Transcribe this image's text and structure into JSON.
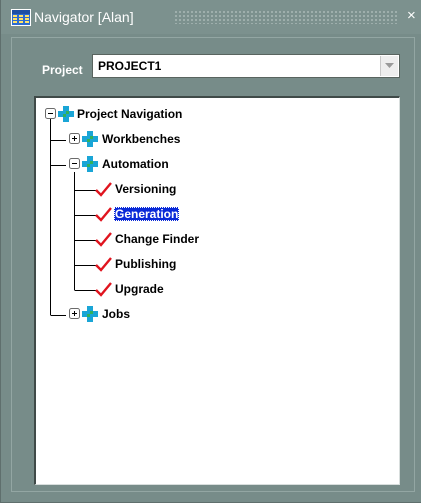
{
  "window": {
    "title": "Navigator [Alan]",
    "close_glyph": "×"
  },
  "project": {
    "label": "Project",
    "value": "PROJECT1"
  },
  "tree": {
    "root": {
      "label": "Project Navigation",
      "expander": "−",
      "icon": "cross-icon"
    },
    "workbenches": {
      "label": "Workbenches",
      "expander": "+",
      "icon": "cross-icon"
    },
    "automation": {
      "label": "Automation",
      "expander": "−",
      "icon": "cross-icon",
      "children": [
        {
          "label": "Versioning",
          "icon": "checkmark-icon",
          "selected": false
        },
        {
          "label": "Generation",
          "icon": "checkmark-icon",
          "selected": true
        },
        {
          "label": "Change Finder",
          "icon": "checkmark-icon",
          "selected": false
        },
        {
          "label": "Publishing",
          "icon": "checkmark-icon",
          "selected": false
        },
        {
          "label": "Upgrade",
          "icon": "checkmark-icon",
          "selected": false
        }
      ]
    },
    "jobs": {
      "label": "Jobs",
      "expander": "+",
      "icon": "cross-icon"
    }
  },
  "colors": {
    "window_bg": "#778c89",
    "selection": "#0a2ad8",
    "checkmark": "#e0141e",
    "cross_blue": "#1aa5d6",
    "cross_green": "#33b15a"
  }
}
